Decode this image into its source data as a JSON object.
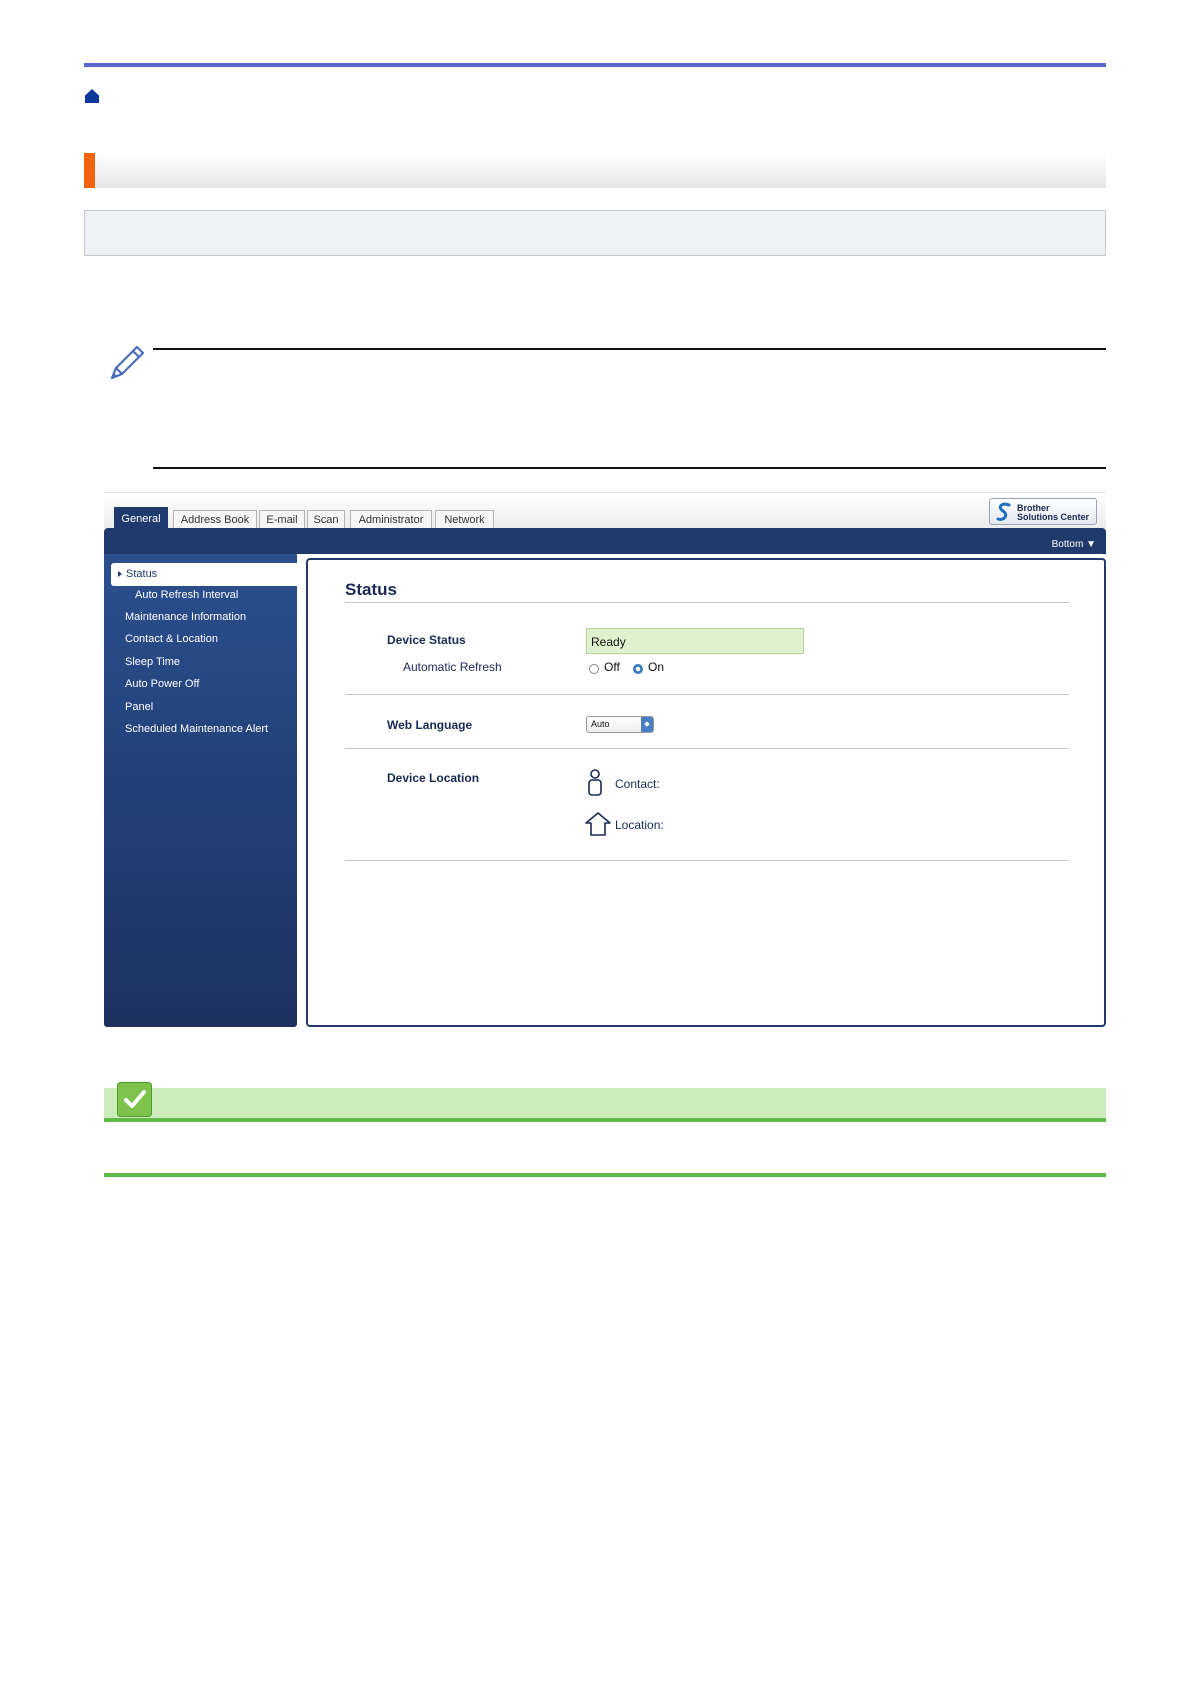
{
  "colors": {
    "top_rule": "#5867c8",
    "section_accent": "#f2630f",
    "nav_blue": "#203a6c",
    "ready_green": "#dff2cf",
    "check_green": "#5dbb46"
  },
  "icons": {
    "home": "home-icon",
    "note": "pencil-icon",
    "related": "check-icon",
    "contact": "person-icon",
    "location": "house-icon",
    "brand": "solutions-center-logo"
  },
  "webui": {
    "tabs": [
      {
        "label": "General",
        "active": true
      },
      {
        "label": "Address Book",
        "active": false
      },
      {
        "label": "E-mail",
        "active": false
      },
      {
        "label": "Scan",
        "active": false
      },
      {
        "label": "Administrator",
        "active": false
      },
      {
        "label": "Network",
        "active": false
      }
    ],
    "brand": {
      "line1": "Brother",
      "line2": "Solutions Center"
    },
    "bottom_link": "Bottom ▼",
    "sidebar": {
      "active": "Status",
      "items": [
        "Auto Refresh Interval",
        "Maintenance Information",
        "Contact & Location",
        "Sleep Time",
        "Auto Power Off",
        "Panel",
        "Scheduled Maintenance Alert"
      ]
    },
    "content": {
      "title": "Status",
      "device_status_label": "Device Status",
      "device_status_value": "Ready",
      "auto_refresh_label": "Automatic Refresh",
      "auto_refresh_off": "Off",
      "auto_refresh_on": "On",
      "auto_refresh_selected": "On",
      "web_language_label": "Web Language",
      "web_language_value": "Auto",
      "device_location_label": "Device Location",
      "contact_label": "Contact:",
      "location_label": "Location:"
    }
  }
}
